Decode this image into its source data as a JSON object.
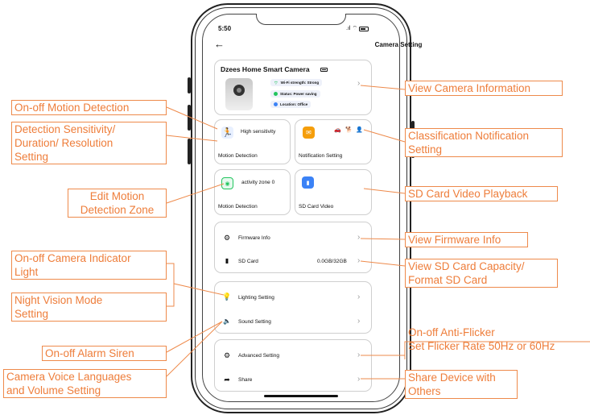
{
  "status_bar": {
    "time": "5:50",
    "signal": ".ıl",
    "wifi": "⌔"
  },
  "header": {
    "back_icon": "back-arrow-icon",
    "title": "Camera Setting"
  },
  "camera_card": {
    "name": "Dzees Home Smart Camera",
    "wifi": "Wi-Fi strength: Strong",
    "status": "Status: Power saving",
    "location": "Location: Office"
  },
  "motion_card": {
    "value": "High sensitivity",
    "label": "Motion Detection"
  },
  "notification_card": {
    "label": "Notification Setting"
  },
  "zone_card": {
    "value": "activity zone 0",
    "label": "Motion Detection"
  },
  "sd_video_card": {
    "label": "SD Card Video"
  },
  "info_group": {
    "firmware_label": "Firmware Info",
    "sd_label": "SD Card",
    "sd_value": "0.0GB/32GB"
  },
  "light_group": {
    "lighting_label": "Lighting Setting",
    "sound_label": "Sound Setting"
  },
  "advanced_group": {
    "advanced_label": "Advanced Setting",
    "share_label": "Share"
  },
  "annotations": {
    "motion_onoff": "On-off Motion Detection",
    "sensitivity": [
      "Detection Sensitivity/",
      "Duration/ Resolution",
      "Setting"
    ],
    "edit_zone": [
      "Edit Motion",
      "Detection Zone"
    ],
    "indicator": [
      "On-off Camera Indicator",
      "Light"
    ],
    "night_vision": [
      "Night Vision Mode",
      "Setting"
    ],
    "siren": "On-off Alarm Siren",
    "voice": [
      "Camera Voice Languages",
      "and Volume Setting"
    ],
    "camera_info": "View Camera Information",
    "classification": [
      "Classification Notification",
      "Setting"
    ],
    "sd_playback": "SD Card Video Playback",
    "firmware": "View Firmware Info",
    "sd_capacity": [
      "View SD Card Capacity/",
      "Format SD Card"
    ],
    "anti_flicker": [
      "On-off Anti-Flicker",
      "Set Flicker Rate 50Hz or 60Hz"
    ],
    "share": [
      "Share Device with",
      "Others"
    ]
  },
  "colors": {
    "annotation": "#ee7d3a",
    "icon_blue": "#3b82f6",
    "icon_orange": "#f59e0b",
    "icon_green": "#22c55e"
  }
}
